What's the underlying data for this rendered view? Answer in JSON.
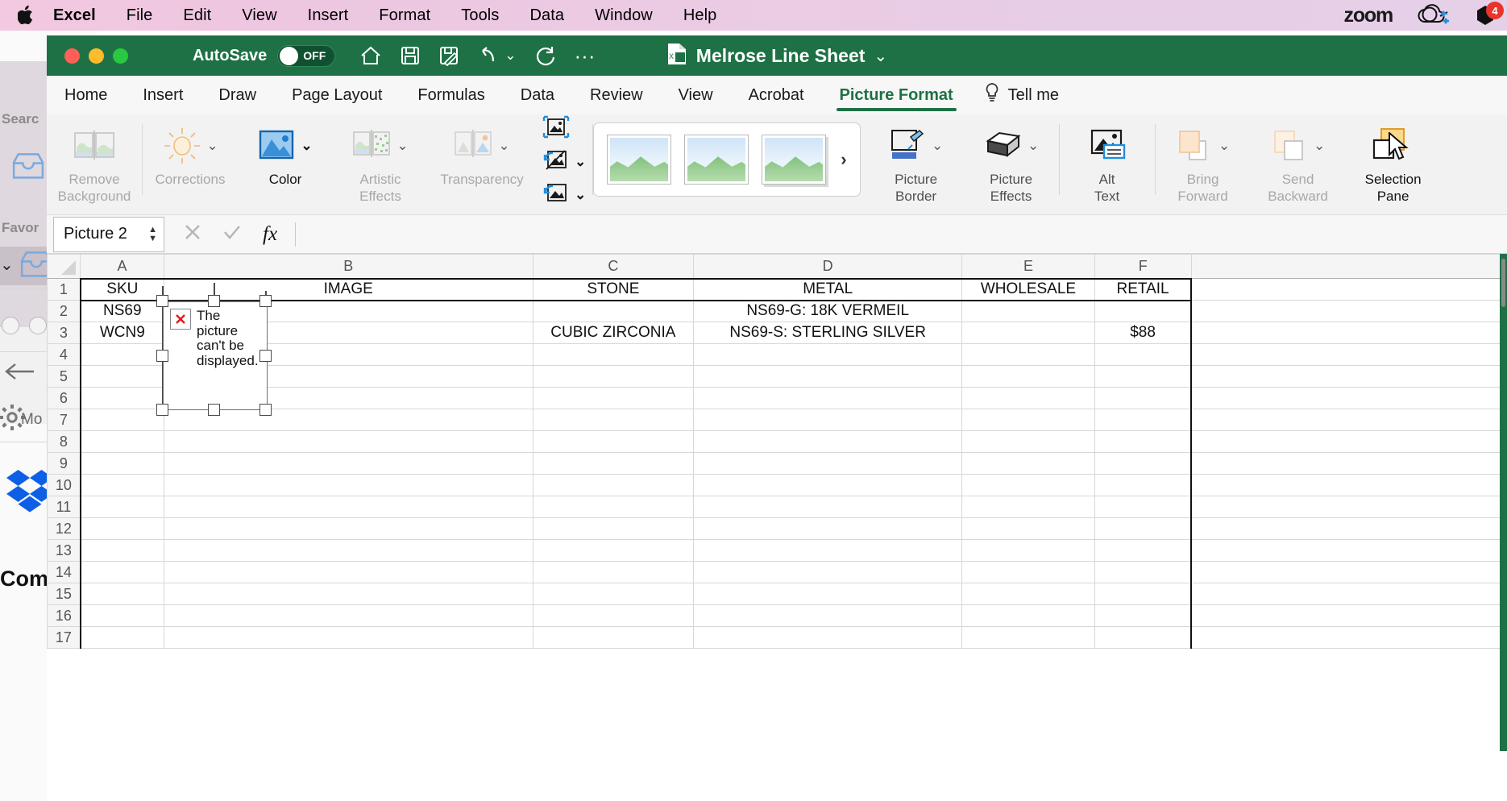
{
  "menubar": {
    "apple_icon": "apple-logo-icon",
    "items": [
      "Excel",
      "File",
      "Edit",
      "View",
      "Insert",
      "Format",
      "Tools",
      "Data",
      "Window",
      "Help"
    ],
    "right": {
      "zoom_logo": "zoom",
      "onedrive_icon": "onedrive-sync-icon",
      "notification_icon": "notification-icon",
      "badge_count": "4"
    }
  },
  "window": {
    "autosave_label": "AutoSave",
    "autosave_state": "OFF",
    "document_title": "Melrose Line Sheet",
    "quick_access": [
      "home-icon",
      "save-icon",
      "save-as-icon",
      "undo-icon",
      "undo-chevron-icon",
      "redo-icon",
      "more-icon"
    ],
    "title_chevron": "chevron-down-icon",
    "traffic_lights": [
      "close",
      "minimize",
      "zoom"
    ]
  },
  "ribbon": {
    "tabs": [
      "Home",
      "Insert",
      "Draw",
      "Page Layout",
      "Formulas",
      "Data",
      "Review",
      "View",
      "Acrobat",
      "Picture Format"
    ],
    "active_tab": "Picture Format",
    "tell_me": "Tell me",
    "tell_me_icon": "lightbulb-icon",
    "groups": [
      {
        "items": [
          {
            "label_line1": "Remove",
            "label_line2": "Background",
            "icon": "remove-background-icon",
            "state": "disabled"
          }
        ]
      },
      {
        "items": [
          {
            "label_line1": "Corrections",
            "label_line2": "",
            "icon": "corrections-sun-icon",
            "state": "disabled",
            "chevron": true
          },
          {
            "label_line1": "Color",
            "label_line2": "",
            "icon": "color-picture-icon",
            "state": "selected",
            "chevron": true
          },
          {
            "label_line1": "Artistic",
            "label_line2": "Effects",
            "icon": "artistic-effects-icon",
            "state": "disabled",
            "chevron": true
          },
          {
            "label_line1": "Transparency",
            "label_line2": "",
            "icon": "transparency-icon",
            "state": "disabled",
            "chevron": true
          }
        ]
      },
      {
        "items": [
          {
            "icon": "compress-pictures-icon",
            "chevron": true
          },
          {
            "icon": "change-picture-icon",
            "chevron": true
          },
          {
            "icon": "reset-picture-icon",
            "chevron": true
          }
        ]
      },
      {
        "gallery": {
          "name": "picture-styles-gallery",
          "thumbnails": [
            "picture-style-1",
            "picture-style-2",
            "picture-style-3"
          ],
          "more_icon": "gallery-more-icon"
        }
      },
      {
        "items": [
          {
            "label_line1": "Picture",
            "label_line2": "Border",
            "icon": "picture-border-icon",
            "state": "normal",
            "chevron": true
          },
          {
            "label_line1": "Picture",
            "label_line2": "Effects",
            "icon": "picture-effects-icon",
            "state": "normal",
            "chevron": true
          }
        ]
      },
      {
        "items": [
          {
            "label_line1": "Alt",
            "label_line2": "Text",
            "icon": "alt-text-icon",
            "state": "normal"
          }
        ]
      },
      {
        "items": [
          {
            "label_line1": "Bring",
            "label_line2": "Forward",
            "icon": "bring-forward-icon",
            "state": "disabled",
            "chevron": true
          },
          {
            "label_line1": "Send",
            "label_line2": "Backward",
            "icon": "send-backward-icon",
            "state": "disabled",
            "chevron": true
          },
          {
            "label_line1": "Selection",
            "label_line2": "Pane",
            "icon": "selection-pane-icon",
            "state": "normal"
          }
        ]
      }
    ]
  },
  "formula_bar": {
    "name_box_value": "Picture 2",
    "stepper_icon": "name-box-stepper-icon",
    "cancel_icon": "cancel-icon",
    "confirm_icon": "confirm-checkmark-icon",
    "function_icon": "fx",
    "formula_value": ""
  },
  "sheet": {
    "columns": [
      "A",
      "B",
      "C",
      "D",
      "E",
      "F"
    ],
    "row_numbers": [
      "1",
      "2",
      "3",
      "4",
      "5",
      "6",
      "7",
      "8",
      "9",
      "10",
      "11",
      "12",
      "13",
      "14",
      "15",
      "16",
      "17"
    ],
    "headers": [
      "SKU",
      "IMAGE",
      "STONE",
      "METAL",
      "WHOLESALE",
      "RETAIL"
    ],
    "data": {
      "sku_line1": "NS69",
      "sku_line2": "WCN9",
      "stone": "CUBIC ZIRCONIA",
      "metal_line1": "NS69-G: 18K VERMEIL",
      "metal_line2": "NS69-S: STERLING SILVER",
      "wholesale": "",
      "retail": "$88"
    },
    "picture_placeholder": {
      "name": "broken-picture-placeholder",
      "message": "The picture can't be displayed.",
      "icon": "broken-image-icon"
    }
  },
  "background_app": {
    "search_label": "Searc",
    "favorites_label": "Favor",
    "more_label": "Mo",
    "comments_label": "Com",
    "icons": [
      "inbox-icon",
      "inbox-icon",
      "back-arrow-icon",
      "gear-icon",
      "dropbox-logo-icon"
    ]
  }
}
